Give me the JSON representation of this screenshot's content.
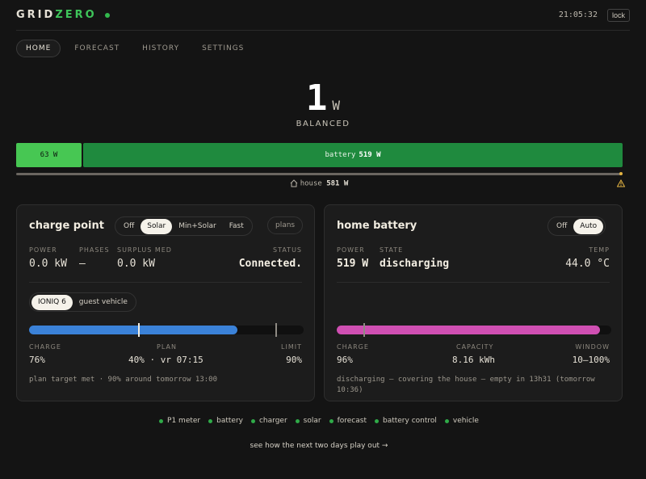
{
  "header": {
    "logo_part1": "GRID",
    "logo_part2": "ZERO",
    "clock": "21:05:32",
    "lock_label": "lock"
  },
  "nav": {
    "tabs": [
      {
        "label": "HOME",
        "active": true
      },
      {
        "label": "FORECAST",
        "active": false
      },
      {
        "label": "HISTORY",
        "active": false
      },
      {
        "label": "SETTINGS",
        "active": false
      }
    ]
  },
  "hero": {
    "value": "1",
    "unit": "W",
    "status": "BALANCED"
  },
  "flow": {
    "solar_label": "63 W",
    "battery_prefix": "battery",
    "battery_value": "519 W",
    "house_prefix": "house",
    "house_value": "581 W"
  },
  "charge_point": {
    "title": "charge point",
    "modes": [
      "Off",
      "Solar",
      "Min+Solar",
      "Fast"
    ],
    "active_mode": "Solar",
    "plans_label": "plans",
    "power_label": "POWER",
    "power_value": "0.0 kW",
    "phases_label": "PHASES",
    "phases_value": "—",
    "surplus_label": "SURPLUS MED",
    "surplus_value": "0.0 kW",
    "status_label": "STATUS",
    "status_value": "Connected.",
    "vehicles": [
      "IONIQ 6",
      "guest vehicle"
    ],
    "active_vehicle": "IONIQ 6",
    "charge_label": "CHARGE",
    "charge_value": "76%",
    "charge_pct": 76,
    "plan_label": "PLAN",
    "plan_value": "40% · vr 07:15",
    "plan_pct": 40,
    "limit_label": "LIMIT",
    "limit_value": "90%",
    "limit_pct": 90,
    "note": "plan target met · 90% around tomorrow 13:00"
  },
  "home_battery": {
    "title": "home battery",
    "modes": [
      "Off",
      "Auto"
    ],
    "active_mode": "Auto",
    "power_label": "POWER",
    "power_value": "519 W",
    "state_label": "STATE",
    "state_value": "discharging",
    "temp_label": "TEMP",
    "temp_value": "44.0 °C",
    "charge_label": "CHARGE",
    "charge_value": "96%",
    "charge_pct": 96,
    "window_min_pct": 10,
    "capacity_label": "CAPACITY",
    "capacity_value": "8.16 kWh",
    "window_label": "WINDOW",
    "window_value": "10–100%",
    "note_line1": "discharging — covering the house — empty in 13h31 (tomorrow",
    "note_line2": "10:36)"
  },
  "status_items": [
    "P1 meter",
    "battery",
    "charger",
    "solar",
    "forecast",
    "battery control",
    "vehicle"
  ],
  "cta": "see how the next two days play out →",
  "colors": {
    "accent_green": "#3ec45a",
    "solar": "#47c753",
    "battery_flow": "#1f8a3e",
    "ev_bar": "#3b82d8",
    "battery_bar": "#cf4fb2",
    "warning": "#e3b342"
  }
}
